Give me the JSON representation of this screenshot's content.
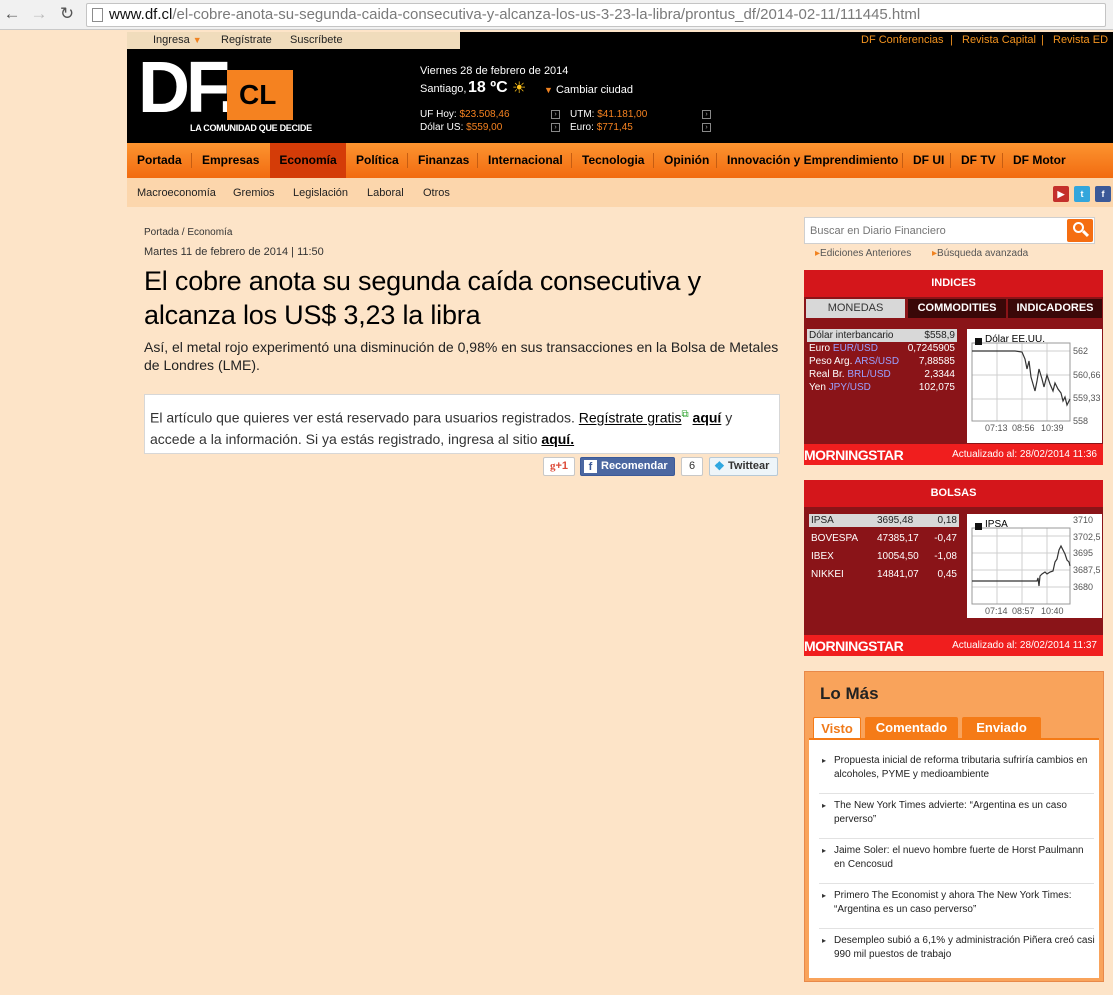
{
  "browser": {
    "url_host": "www.df.cl",
    "url_path": "/el-cobre-anota-su-segunda-caida-consecutiva-y-alcanza-los-us-3-23-la-libra/prontus_df/2014-02-11/111445.html"
  },
  "account": {
    "login": "Ingresa",
    "register": "Regístrate",
    "subscribe": "Suscríbete"
  },
  "external_links": [
    "DF Conferencias",
    "Revista Capital",
    "Revista ED"
  ],
  "header": {
    "logo_df": "DF.",
    "logo_cl": "CL",
    "tagline": "LA COMUNIDAD QUE DECIDE",
    "date": "Viernes 28 de febrero de 2014",
    "city": "Santiago,",
    "temperature": "18 ºC",
    "change_city": "Cambiar ciudad",
    "indicators": [
      {
        "label": "UF Hoy:",
        "value": "$23.508,46"
      },
      {
        "label": "Dólar US:",
        "value": "$559,00"
      },
      {
        "label": "UTM:",
        "value": "$41.181,00"
      },
      {
        "label": "Euro:",
        "value": "$771,45"
      }
    ]
  },
  "main_nav": [
    "Portada",
    "Empresas",
    "Economía",
    "Política",
    "Finanzas",
    "Internacional",
    "Tecnologia",
    "Opinión",
    "Innovación y Emprendimiento",
    "DF UI",
    "DF TV",
    "DF Motor"
  ],
  "sub_nav": [
    "Macroeconomía",
    "Gremios",
    "Legislación",
    "Laboral",
    "Otros"
  ],
  "article": {
    "breadcrumb": "Portada / Economía",
    "date": "Martes 11 de febrero de 2014 | 11:50",
    "headline": "El cobre anota su segunda caída consecutiva y alcanza los US$ 3,23 la libra",
    "summary": "Así, el metal rojo experimentó una disminución de 0,98% en sus transacciones en la Bolsa de Metales de Londres (LME).",
    "paywall_before": "El artículo que quieres ver está reservado para usuarios registrados. ",
    "paywall_register": "Regístrate gratis",
    "paywall_here": "aquí",
    "paywall_middle": " y accede a la información. Si ya estás registrado, ingresa al sitio ",
    "paywall_here2": "aquí."
  },
  "share": {
    "gplus": "+1",
    "recommend": "Recomendar",
    "fb_count": "6",
    "twitter": "Twittear"
  },
  "search": {
    "placeholder": "Buscar en Diario Financiero",
    "links": [
      "Ediciones Anteriores",
      "Búsqueda avanzada"
    ]
  },
  "indices": {
    "title": "INDICES",
    "tabs": [
      "MONEDAS",
      "COMMODITIES",
      "INDICADORES"
    ],
    "rows": [
      {
        "label": "Dólar interbancario",
        "code": "",
        "value": "$558,9"
      },
      {
        "label": "Euro",
        "code": "EUR/USD",
        "value": "0,7245905"
      },
      {
        "label": "Peso Arg.",
        "code": "ARS/USD",
        "value": "7,88585"
      },
      {
        "label": "Real Br.",
        "code": "BRL/USD",
        "value": "2,3344"
      },
      {
        "label": "Yen",
        "code": "JPY/USD",
        "value": "102,075"
      }
    ],
    "chart_title": "Dólar EE.UU.",
    "y_ticks": [
      "562",
      "560,66",
      "559,33",
      "558"
    ],
    "x_ticks": [
      "07:13",
      "08:56",
      "10:39"
    ],
    "footer_logo": "MORNINGSTAR",
    "updated": "Actualizado al: 28/02/2014 11:36"
  },
  "bolsas": {
    "title": "BOLSAS",
    "rows": [
      {
        "name": "IPSA",
        "value": "3695,48",
        "change": "0,18"
      },
      {
        "name": "BOVESPA",
        "value": "47385,17",
        "change": "-0,47"
      },
      {
        "name": "IBEX",
        "value": "10054,50",
        "change": "-1,08"
      },
      {
        "name": "NIKKEI",
        "value": "14841,07",
        "change": "0,45"
      }
    ],
    "chart_title": "IPSA",
    "y_ticks": [
      "3710",
      "3702,5",
      "3695",
      "3687,5",
      "3680"
    ],
    "x_ticks": [
      "07:14",
      "08:57",
      "10:40"
    ],
    "footer_logo": "MORNINGSTAR",
    "updated": "Actualizado al: 28/02/2014 11:37"
  },
  "lo_mas": {
    "title": "Lo Más",
    "tabs": [
      "Visto",
      "Comentado",
      "Enviado"
    ],
    "items": [
      "Propuesta inicial de reforma tributaria sufriría cambios en alcoholes, PYME y medioambiente",
      "The New York Times advierte: “Argentina es un caso perverso”",
      "Jaime Soler: el nuevo hombre fuerte de Horst Paulmann en Cencosud",
      "Primero The Economist y ahora The New York Times: “Argentina es un caso perverso”",
      "Desempleo subió a 6,1% y administración Piñera creó casi 990 mil puestos de trabajo"
    ]
  },
  "colors": {
    "page_bg": "#fde4c8",
    "nav_orange": "#f58220",
    "active_nav": "#d43c08",
    "market_red": "#d4161b",
    "market_dark": "#8a1418"
  }
}
